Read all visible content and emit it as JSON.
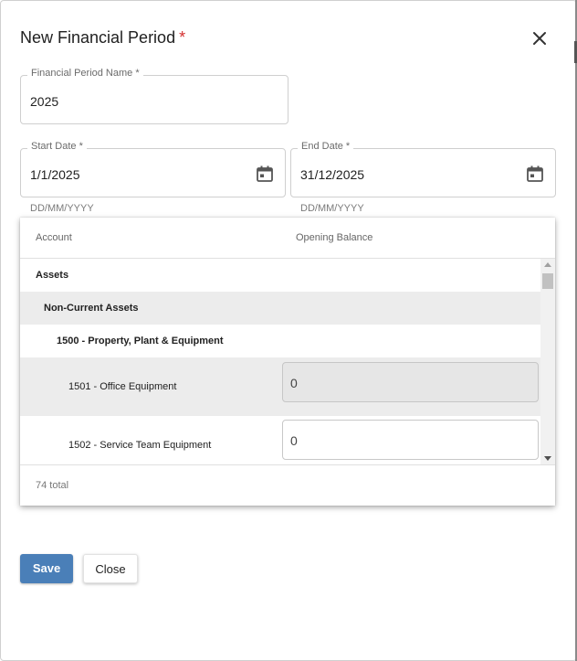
{
  "dialog": {
    "title": "New Financial Period",
    "required_mark": "*",
    "close_icon": "close-icon"
  },
  "form": {
    "period_name": {
      "label": "Financial Period Name *",
      "value": "2025"
    },
    "start_date": {
      "label": "Start Date *",
      "value": "1/1/2025",
      "hint": "DD/MM/YYYY",
      "icon": "calendar-icon"
    },
    "end_date": {
      "label": "End Date *",
      "value": "31/12/2025",
      "hint": "DD/MM/YYYY",
      "icon": "calendar-icon"
    }
  },
  "grid": {
    "columns": [
      "Account",
      "Opening Balance"
    ],
    "rows": [
      {
        "label": "Assets",
        "type": "group-1"
      },
      {
        "label": "Non-Current Assets",
        "type": "group-2"
      },
      {
        "label": "1500 - Property, Plant & Equipment",
        "type": "group-3"
      },
      {
        "label": "1501 - Office Equipment",
        "type": "account",
        "opening_balance": "0",
        "disabled": true
      },
      {
        "label": "1502 - Service Team Equipment",
        "type": "account",
        "opening_balance": "0",
        "disabled": false
      }
    ],
    "footer": "74 total"
  },
  "actions": {
    "save_label": "Save",
    "close_label": "Close"
  },
  "colors": {
    "primary": "#4a7fb8",
    "required": "#d32f2f"
  }
}
